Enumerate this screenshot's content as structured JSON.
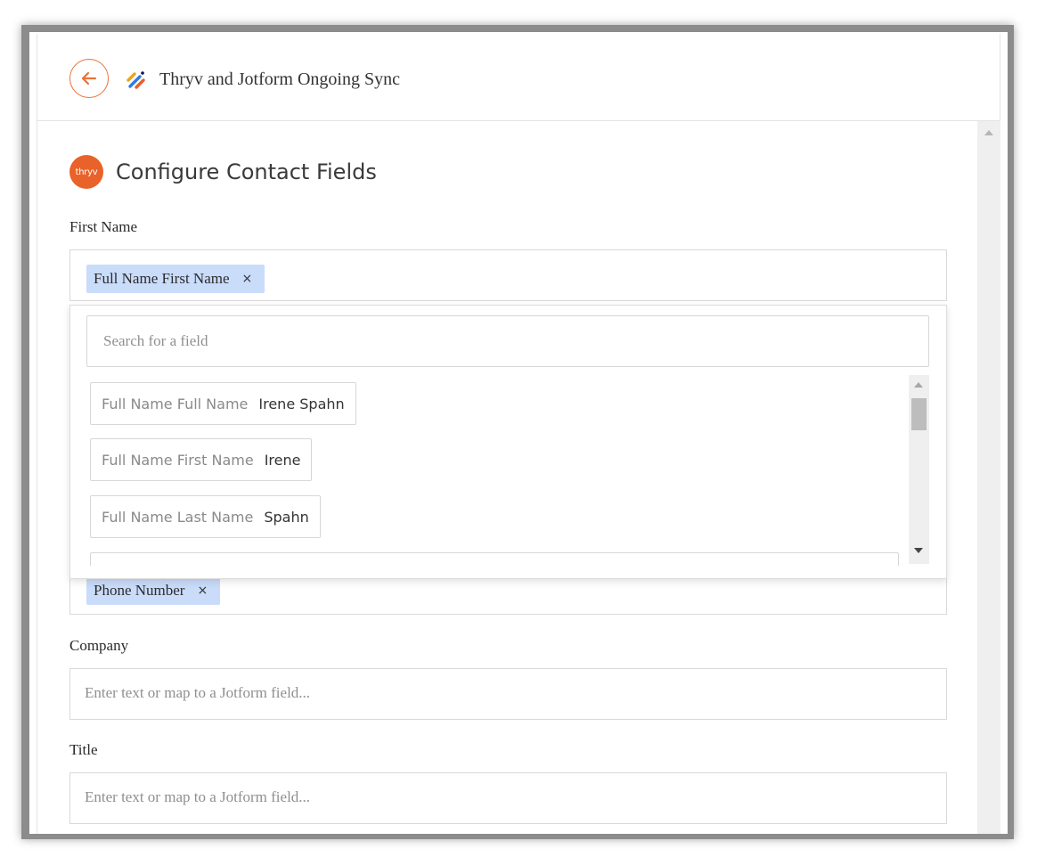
{
  "header": {
    "title": "Thryv and Jotform Ongoing Sync",
    "back_icon": "arrow-left-icon",
    "app_icon": "jotform-logo-icon"
  },
  "section": {
    "icon_text": "thryv",
    "title": "Configure Contact Fields"
  },
  "fields": {
    "first_name": {
      "label": "First Name",
      "chip": "Full Name First Name",
      "chip_close": "×"
    },
    "phone": {
      "chip": "Phone Number",
      "chip_close": "×"
    },
    "company": {
      "label": "Company",
      "placeholder": "Enter text or map to a Jotform field..."
    },
    "title": {
      "label": "Title",
      "placeholder": "Enter text or map to a Jotform field..."
    }
  },
  "dropdown": {
    "search_placeholder": "Search for a field",
    "options": [
      {
        "name": "Full Name Full Name",
        "value": "Irene Spahn"
      },
      {
        "name": "Full Name First Name",
        "value": "Irene"
      },
      {
        "name": "Full Name Last Name",
        "value": "Spahn"
      }
    ]
  },
  "colors": {
    "accent": "#e8733a",
    "brand": "#e8622a",
    "chip_bg": "#c9dcfa"
  }
}
